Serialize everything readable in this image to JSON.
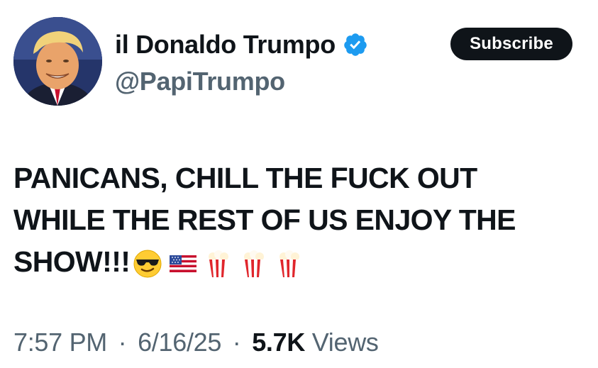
{
  "author": {
    "display_name": "il Donaldo Trumpo",
    "handle": "@PapiTrumpo",
    "verified": true,
    "verified_color": "#1d9bf0",
    "avatar_icon": "profile-photo"
  },
  "subscribe_label": "Subscribe",
  "tweet": {
    "lines": [
      "PANICANS, CHILL THE FUCK OUT",
      "WHILE THE REST OF US ENJOY THE",
      "SHOW!!!"
    ],
    "emojis": [
      "smiling-face-with-sunglasses",
      "us-flag",
      "popcorn",
      "popcorn",
      "popcorn"
    ]
  },
  "meta": {
    "time": "7:57 PM",
    "separator": "·",
    "date": "6/16/25",
    "views_count": "5.7K",
    "views_label": "Views"
  },
  "colors": {
    "text": "#0f1419",
    "secondary": "#536471",
    "button_bg": "#0f1419"
  }
}
